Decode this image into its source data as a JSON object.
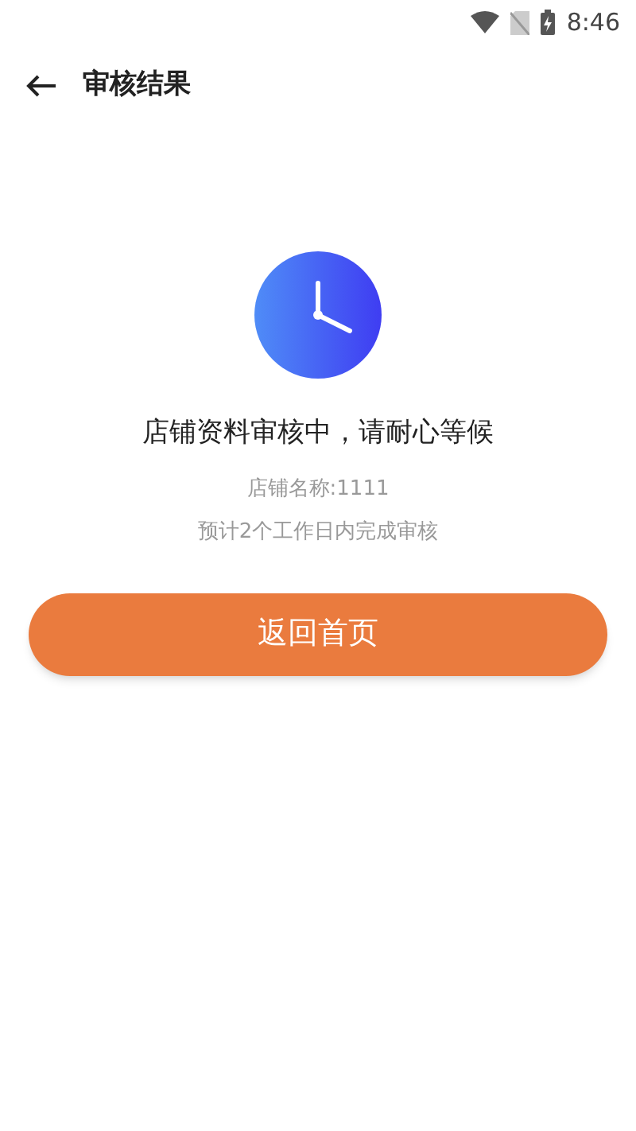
{
  "status_bar": {
    "time": "8:46"
  },
  "header": {
    "title": "审核结果"
  },
  "result": {
    "message": "店铺资料审核中，请耐心等候",
    "shop_name": "店铺名称:1111",
    "estimate": "预计2个工作日内完成审核"
  },
  "button": {
    "label": "返回首页"
  }
}
